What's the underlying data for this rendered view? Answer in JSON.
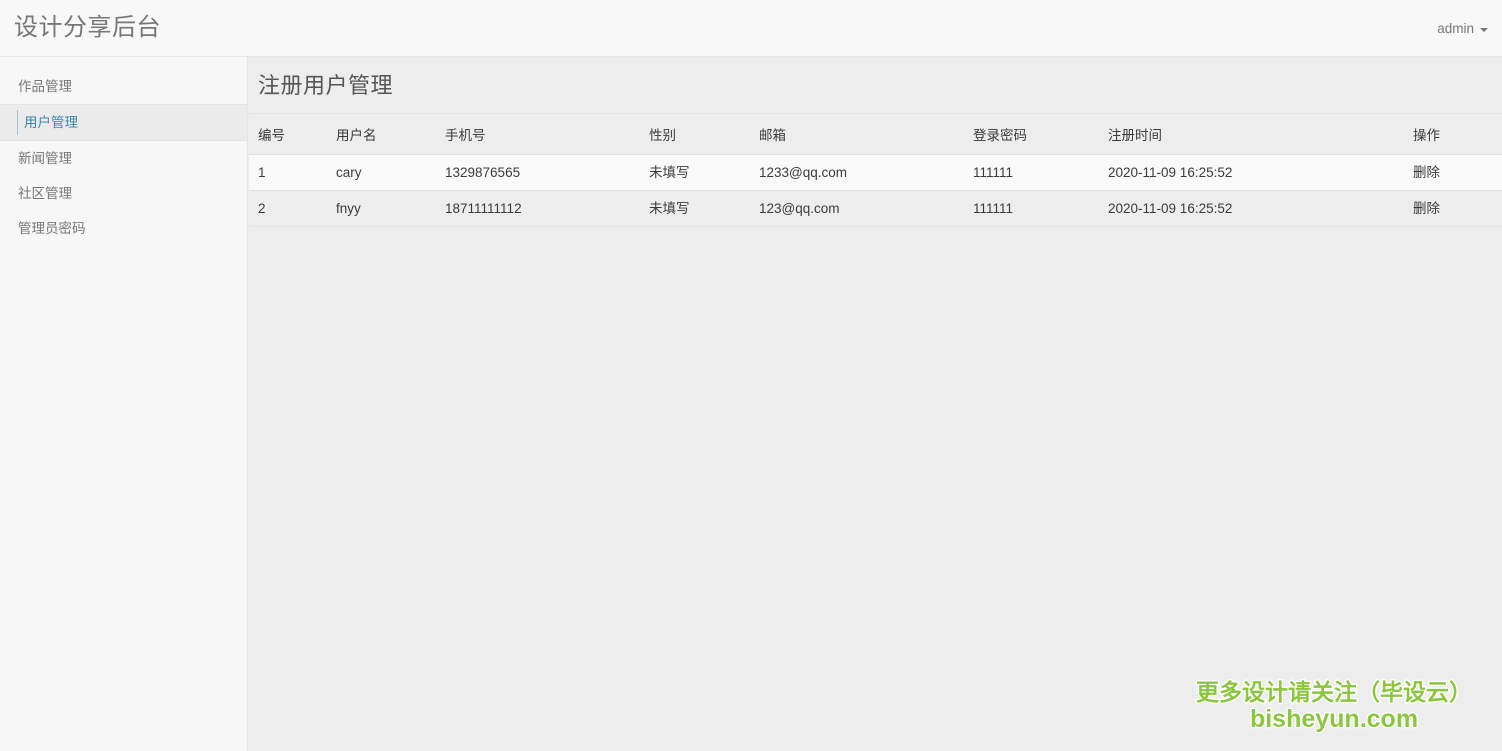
{
  "navbar": {
    "brand": "设计分享后台",
    "user_label": "admin",
    "caret_icon": "chevron-down-icon"
  },
  "sidebar": {
    "items": [
      {
        "label": "作品管理",
        "active": false
      },
      {
        "label": "用户管理",
        "active": true
      },
      {
        "label": "新闻管理",
        "active": false
      },
      {
        "label": "社区管理",
        "active": false
      },
      {
        "label": "管理员密码",
        "active": false
      }
    ]
  },
  "main": {
    "title": "注册用户管理",
    "table": {
      "columns": [
        "编号",
        "用户名",
        "手机号",
        "性别",
        "邮箱",
        "登录密码",
        "注册时间",
        "操作"
      ],
      "rows": [
        {
          "id": "1",
          "username": "cary",
          "phone": "1329876565",
          "gender": "未填写",
          "email": "1233@qq.com",
          "password": "111111",
          "register_time": "2020-11-09 16:25:52",
          "action": "删除"
        },
        {
          "id": "2",
          "username": "fnyy",
          "phone": "18711111112",
          "gender": "未填写",
          "email": "123@qq.com",
          "password": "111111",
          "register_time": "2020-11-09 16:25:52",
          "action": "删除"
        }
      ]
    }
  },
  "watermark": {
    "line1": "更多设计请关注（毕设云）",
    "line2": "bisheyun.com",
    "color": "#8cc63f"
  }
}
